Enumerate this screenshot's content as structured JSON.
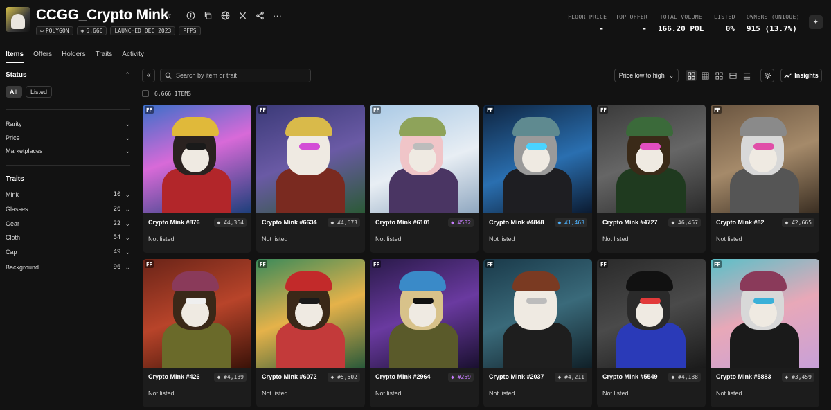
{
  "collection": {
    "title": "CCGG_Crypto Mink",
    "badges": [
      "POLYGON",
      "6,666",
      "LAUNCHED DEC 2023",
      "PFPS"
    ]
  },
  "stats": [
    {
      "label": "FLOOR PRICE",
      "value": "-"
    },
    {
      "label": "TOP OFFER",
      "value": "-"
    },
    {
      "label": "TOTAL VOLUME",
      "value": "166.20 POL"
    },
    {
      "label": "LISTED",
      "value": "0%"
    },
    {
      "label": "OWNERS (UNIQUE)",
      "value": "915 (13.7%)"
    }
  ],
  "tabs": [
    "Items",
    "Offers",
    "Holders",
    "Traits",
    "Activity"
  ],
  "sidebar": {
    "status_title": "Status",
    "status_all": "All",
    "status_listed": "Listed",
    "filters": [
      "Rarity",
      "Price",
      "Marketplaces"
    ],
    "traits_title": "Traits",
    "traits": [
      {
        "name": "Mink",
        "count": "10"
      },
      {
        "name": "Glasses",
        "count": "26"
      },
      {
        "name": "Gear",
        "count": "22"
      },
      {
        "name": "Cloth",
        "count": "54"
      },
      {
        "name": "Cap",
        "count": "49"
      },
      {
        "name": "Background",
        "count": "96"
      }
    ]
  },
  "toolbar": {
    "search_placeholder": "Search by item or trait",
    "sort_label": "Price low to high",
    "insights_label": "Insights",
    "item_count": "6,666 ITEMS"
  },
  "items": [
    {
      "name": "Crypto Mink #876",
      "rank": "#4,364",
      "status": "Not listed",
      "rank_color": "#d9d9d9"
    },
    {
      "name": "Crypto Mink #6634",
      "rank": "#4,673",
      "status": "Not listed",
      "rank_color": "#d9d9d9"
    },
    {
      "name": "Crypto Mink #6101",
      "rank": "#582",
      "status": "Not listed",
      "rank_color": "#c77dff"
    },
    {
      "name": "Crypto Mink #4848",
      "rank": "#1,463",
      "status": "Not listed",
      "rank_color": "#4fb3ff"
    },
    {
      "name": "Crypto Mink #4727",
      "rank": "#6,457",
      "status": "Not listed",
      "rank_color": "#d9d9d9"
    },
    {
      "name": "Crypto Mink #82",
      "rank": "#2,665",
      "status": "Not listed",
      "rank_color": "#d9d9d9"
    },
    {
      "name": "Crypto Mink #426",
      "rank": "#4,139",
      "status": "Not listed",
      "rank_color": "#d9d9d9"
    },
    {
      "name": "Crypto Mink #6072",
      "rank": "#5,502",
      "status": "Not listed",
      "rank_color": "#d9d9d9"
    },
    {
      "name": "Crypto Mink #2964",
      "rank": "#259",
      "status": "Not listed",
      "rank_color": "#c77dff"
    },
    {
      "name": "Crypto Mink #2037",
      "rank": "#4,211",
      "status": "Not listed",
      "rank_color": "#d9d9d9"
    },
    {
      "name": "Crypto Mink #5549",
      "rank": "#4,188",
      "status": "Not listed",
      "rank_color": "#d9d9d9"
    },
    {
      "name": "Crypto Mink #5883",
      "rank": "#3,459",
      "status": "Not listed",
      "rank_color": "#d9d9d9"
    }
  ],
  "thumb_styles": [
    {
      "bg": "linear-gradient(160deg,#3a6fc9,#d86ad8 45%,#1c3f7a)",
      "body": "#b2262a",
      "head": "#2a2220",
      "hat": "#e0b93a",
      "glasses": "#1a1a1a"
    },
    {
      "bg": "linear-gradient(160deg,#3b3a78,#6a5aa5 50%,#2b5a36)",
      "body": "#7a2a20",
      "head": "#efeae2",
      "hat": "#d9ba4a",
      "glasses": "#d34ed6"
    },
    {
      "bg": "linear-gradient(160deg,#a9c9e5,#e8eef4 55%,#8fa7c0)",
      "body": "#4a3563",
      "head": "#f0c5c8",
      "hat": "#8ea35a",
      "glasses": "#bcbcbc"
    },
    {
      "bg": "linear-gradient(160deg,#0e2440,#2a6fb0 55%,#0b1a30)",
      "body": "#1e1e22",
      "head": "#9a9a9a",
      "hat": "#5f8a90",
      "glasses": "#4ad3ff"
    },
    {
      "bg": "linear-gradient(160deg,#3a3a3a,#666 50%,#2a2a2a)",
      "body": "#1f3a1f",
      "head": "#3a2a18",
      "hat": "#3b6a3a",
      "glasses": "#e24ec0"
    },
    {
      "bg": "linear-gradient(160deg,#6a5540,#a58a6a 50%,#3a2e22)",
      "body": "#555",
      "head": "#d8d8d8",
      "hat": "#8a8a8a",
      "glasses": "#e04ea8"
    },
    {
      "bg": "linear-gradient(160deg,#6a2418,#b8442a 50%,#3a1208)",
      "body": "#6a6a2a",
      "head": "#3a2818",
      "hat": "#8a3a5a",
      "glasses": "#efefef"
    },
    {
      "bg": "linear-gradient(160deg,#3a8a5a,#e5b24a 50%,#2a5a3a)",
      "body": "#c33a3a",
      "head": "#3a2818",
      "hat": "#c22a2a",
      "glasses": "#1a1a1a"
    },
    {
      "bg": "linear-gradient(160deg,#2a1a4a,#6a3aa0 50%,#1a1030)",
      "body": "#5a5a2a",
      "head": "#d8c28a",
      "hat": "#3a8ac8",
      "glasses": "#111"
    },
    {
      "bg": "linear-gradient(160deg,#1a3a4a,#3a6a7a 50%,#102028)",
      "body": "#1e1e1e",
      "head": "#efeae2",
      "hat": "#7a3a22",
      "glasses": "#bcbcbc"
    },
    {
      "bg": "linear-gradient(160deg,#2a2a2a,#4a4a4a 50%,#1a1a1a)",
      "body": "#2a3ab8",
      "head": "#2a2a2a",
      "hat": "#111",
      "glasses": "#e23a3a"
    },
    {
      "bg": "linear-gradient(160deg,#5ac0c8,#e8a8b8 50%,#c8a0d8)",
      "body": "#1a1a1a",
      "head": "#d8d8d8",
      "hat": "#8a3a5a",
      "glasses": "#3ab0d8"
    }
  ]
}
